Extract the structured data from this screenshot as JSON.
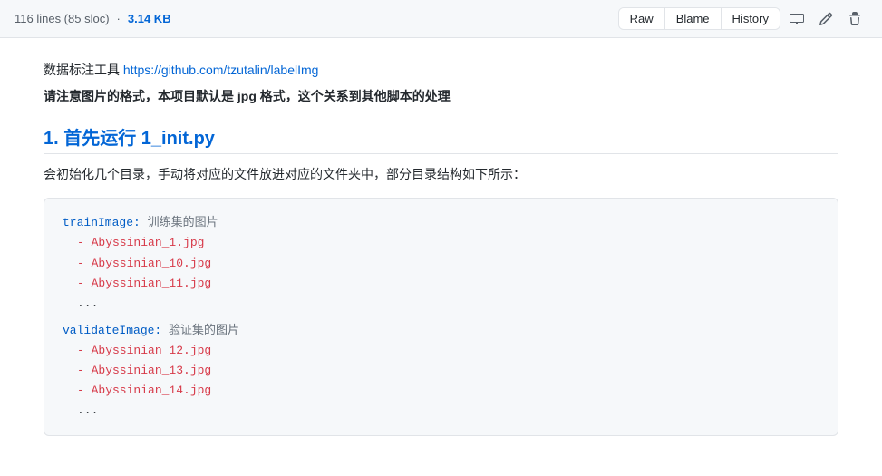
{
  "toolbar": {
    "lines": "116 lines (85 sloc)",
    "size": "3.14 KB",
    "raw_label": "Raw",
    "blame_label": "Blame",
    "history_label": "History"
  },
  "content": {
    "annotation_tool_label": "数据标注工具",
    "annotation_tool_link_text": "https://github.com/tzutalin/labelImg",
    "annotation_tool_link_href": "https://github.com/tzutalin/labelImg",
    "warning_line": "请注意图片的格式，本项目默认是 jpg 格式，这个关系到其他脚本的处理",
    "heading": "1. 首先运行 1_init.py",
    "description": "会初始化几个目录，手动将对应的文件放进对应的文件夹中，部分目录结构如下所示：",
    "code_block1": {
      "trainImage_key": "trainImage:",
      "trainImage_comment": "训练集的图片",
      "trainImage_items": [
        "- Abyssinian_1.jpg",
        "- Abyssinian_10.jpg",
        "- Abyssinian_11.jpg"
      ],
      "trainImage_ellipsis": "...",
      "validateImage_key": "validateImage:",
      "validateImage_comment": "验证集的图片",
      "validateImage_items": [
        "- Abyssinian_12.jpg",
        "- Abyssinian_13.jpg",
        "- Abyssinian_14.jpg"
      ],
      "validateImage_ellipsis": "..."
    }
  }
}
